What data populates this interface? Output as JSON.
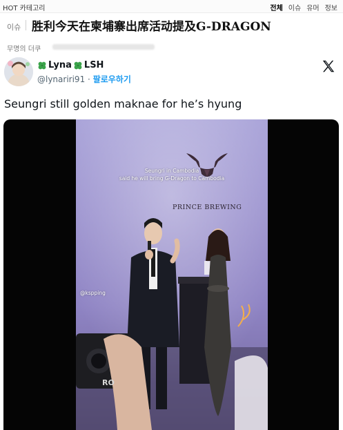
{
  "topbar": {
    "hot_label": "HOT 카테고리",
    "nav": [
      {
        "label": "전체",
        "active": true
      },
      {
        "label": "이슈",
        "active": false
      },
      {
        "label": "유머",
        "active": false
      },
      {
        "label": "정보",
        "active": false
      }
    ]
  },
  "post": {
    "category": "이슈",
    "title": "胜利今天在柬埔寨出席活动提及G-DRAGON",
    "author_label": "무명의 더쿠"
  },
  "tweet": {
    "display_name": "Lyna",
    "display_name_suffix": "LSH",
    "handle": "@lynariri91",
    "separator": "·",
    "follow_label": "팔로우하기",
    "text": "Seungri still golden maknae for he’s hyung",
    "icons": {
      "clover": "four-leaf-clover-icon",
      "x": "x-logo-icon"
    }
  },
  "video": {
    "caption_line1": "Seungri in Cambodia",
    "caption_line2": "said he will bring G-Dragon to Cambodia",
    "brand_text": "PRINCE BREWING",
    "watermark": "@kspping",
    "camera_text": "RO"
  },
  "colors": {
    "accent": "#1d9bf0",
    "text": "#0f1419",
    "muted": "#536471",
    "stage": "#9c93cf"
  }
}
